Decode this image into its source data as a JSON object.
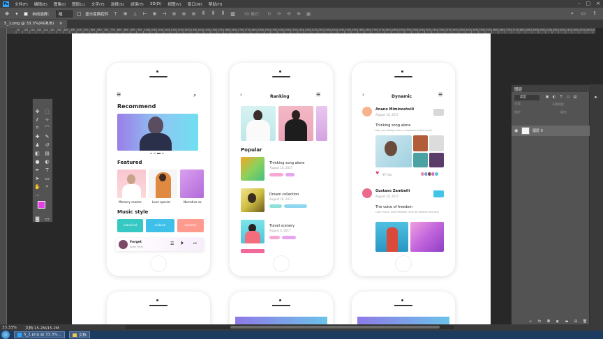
{
  "menu": {
    "logo": "Ps",
    "items": [
      "文件(F)",
      "编辑(E)",
      "图像(I)",
      "图层(L)",
      "文字(Y)",
      "选择(S)",
      "滤镜(T)",
      "3D(D)",
      "视图(V)",
      "窗口(W)",
      "帮助(H)"
    ]
  },
  "options": {
    "auto_select_label": "自动选择：",
    "auto_select_value": "组",
    "show_transform_label": "显示变换控件",
    "mode_3d": "3D 模式："
  },
  "doc_tab": {
    "label": "5_1.png @ 33.3%(RGB/8)",
    "close": "×"
  },
  "ruler_marks": [
    "50",
    "100",
    "150",
    "200",
    "250",
    "300",
    "350",
    "400",
    "450",
    "500",
    "550",
    "600",
    "650",
    "700",
    "750",
    "800",
    "850",
    "900",
    "950",
    "1000",
    "1050",
    "1100",
    "1150",
    "1200",
    "1250",
    "1300",
    "1350",
    "1400",
    "1450",
    "1500",
    "1550",
    "1600",
    "1650",
    "1700",
    "1750",
    "1800",
    "1850",
    "1900",
    "1950",
    "2000",
    "2050",
    "2100",
    "2150",
    "2200",
    "2250",
    "2300",
    "2350",
    "2400",
    "2450",
    "2500",
    "2550",
    "2600",
    "2650",
    "2700",
    "2750",
    "2800",
    "2850",
    "2900",
    "2950",
    "3000",
    "3050",
    "3100",
    "3150",
    "3200",
    "3250",
    "3300",
    "3350",
    "3400",
    "3450",
    "3500",
    "3550",
    "3600",
    "3650",
    "3700",
    "3750",
    "3800",
    "3850",
    "3900",
    "3950",
    "4000",
    "4050",
    "4100",
    "4150",
    "4200",
    "4250",
    "4300",
    "4350"
  ],
  "layers": {
    "title": "图层",
    "kind": "类型",
    "blend": "正常",
    "opacity_label": "不透明度：",
    "lock_label": "锁定：",
    "fill_label": "填充：",
    "layer_name": "图层 0"
  },
  "status": {
    "zoom": "33.33%",
    "doc": "文档:15.2M/15.2M"
  },
  "taskbar": {
    "ps_task": "5_1.png @ 33.3%...",
    "folder_task": "文档"
  },
  "phone1": {
    "title": "Recommend",
    "featured": "Featured",
    "featured_items": [
      "Memory master",
      "Love special",
      "Narrative so"
    ],
    "music_style": "Music style",
    "styles": [
      "classical",
      "culture",
      "country"
    ],
    "player_song": "Forget",
    "player_artist": "Justin Peter"
  },
  "phone2": {
    "title": "Ranking",
    "popular": "Popular",
    "songs": [
      {
        "title": "Thinking song alone",
        "date": "August 10, 2017"
      },
      {
        "title": "Dream collection",
        "date": "August 10, 2017"
      },
      {
        "title": "Travel scenery",
        "date": "August 4, 2017"
      }
    ]
  },
  "phone3": {
    "title": "Dynamic",
    "posts": [
      {
        "user": "Anano Miminoshvili",
        "date": "August 10, 2017",
        "headline": "Thinking song alone",
        "desc": "May you always have a response to the lonely",
        "likes": "97 like"
      },
      {
        "user": "Gustavo Zambelli",
        "date": "August 10, 2017",
        "headline": "The voice of freedom",
        "desc": "Love music, love freedom, sing for dreams and sing"
      }
    ]
  },
  "colors": {
    "accent": "#31a8ff",
    "foreground": "#e43ee8",
    "classical": "#36c9c4",
    "culture": "#3fc0e8",
    "country": "#ff9a8f"
  }
}
